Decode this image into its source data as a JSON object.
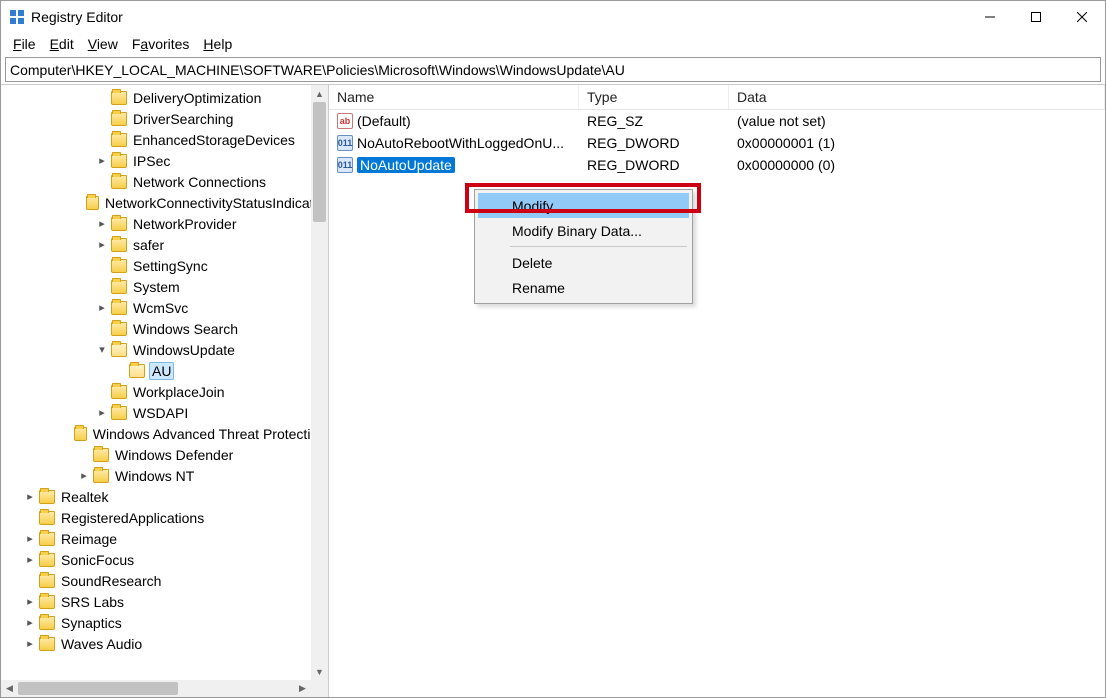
{
  "window": {
    "title": "Registry Editor"
  },
  "menu": {
    "file": "File",
    "edit": "Edit",
    "view": "View",
    "favorites": "Favorites",
    "help": "Help"
  },
  "address": "Computer\\HKEY_LOCAL_MACHINE\\SOFTWARE\\Policies\\Microsoft\\Windows\\WindowsUpdate\\AU",
  "tree": [
    {
      "indent": 5,
      "exp": "",
      "label": "DeliveryOptimization"
    },
    {
      "indent": 5,
      "exp": "",
      "label": "DriverSearching"
    },
    {
      "indent": 5,
      "exp": "",
      "label": "EnhancedStorageDevices"
    },
    {
      "indent": 5,
      "exp": ">",
      "label": "IPSec"
    },
    {
      "indent": 5,
      "exp": "",
      "label": "Network Connections"
    },
    {
      "indent": 5,
      "exp": "",
      "label": "NetworkConnectivityStatusIndicator"
    },
    {
      "indent": 5,
      "exp": ">",
      "label": "NetworkProvider"
    },
    {
      "indent": 5,
      "exp": ">",
      "label": "safer"
    },
    {
      "indent": 5,
      "exp": "",
      "label": "SettingSync"
    },
    {
      "indent": 5,
      "exp": "",
      "label": "System"
    },
    {
      "indent": 5,
      "exp": ">",
      "label": "WcmSvc"
    },
    {
      "indent": 5,
      "exp": "",
      "label": "Windows Search"
    },
    {
      "indent": 5,
      "exp": "v",
      "label": "WindowsUpdate",
      "open": true
    },
    {
      "indent": 6,
      "exp": "",
      "label": "AU",
      "open": true,
      "selected": true
    },
    {
      "indent": 5,
      "exp": "",
      "label": "WorkplaceJoin"
    },
    {
      "indent": 5,
      "exp": ">",
      "label": "WSDAPI"
    },
    {
      "indent": 4,
      "exp": "",
      "label": "Windows Advanced Threat Protection"
    },
    {
      "indent": 4,
      "exp": "",
      "label": "Windows Defender"
    },
    {
      "indent": 4,
      "exp": ">",
      "label": "Windows NT"
    },
    {
      "indent": 1,
      "exp": ">",
      "label": "Realtek"
    },
    {
      "indent": 1,
      "exp": "",
      "label": "RegisteredApplications"
    },
    {
      "indent": 1,
      "exp": ">",
      "label": "Reimage"
    },
    {
      "indent": 1,
      "exp": ">",
      "label": "SonicFocus"
    },
    {
      "indent": 1,
      "exp": "",
      "label": "SoundResearch"
    },
    {
      "indent": 1,
      "exp": ">",
      "label": "SRS Labs"
    },
    {
      "indent": 1,
      "exp": ">",
      "label": "Synaptics"
    },
    {
      "indent": 1,
      "exp": ">",
      "label": "Waves Audio"
    }
  ],
  "columns": {
    "name": "Name",
    "type": "Type",
    "data": "Data"
  },
  "values": [
    {
      "icon": "sz",
      "icon_text": "ab",
      "name": "(Default)",
      "type": "REG_SZ",
      "data": "(value not set)"
    },
    {
      "icon": "dw",
      "icon_text": "011",
      "name": "NoAutoRebootWithLoggedOnU...",
      "type": "REG_DWORD",
      "data": "0x00000001 (1)"
    },
    {
      "icon": "dw",
      "icon_text": "011",
      "name": "NoAutoUpdate",
      "type": "REG_DWORD",
      "data": "0x00000000 (0)",
      "selected": true
    }
  ],
  "context_menu": {
    "modify": "Modify...",
    "modify_binary": "Modify Binary Data...",
    "delete": "Delete",
    "rename": "Rename"
  }
}
